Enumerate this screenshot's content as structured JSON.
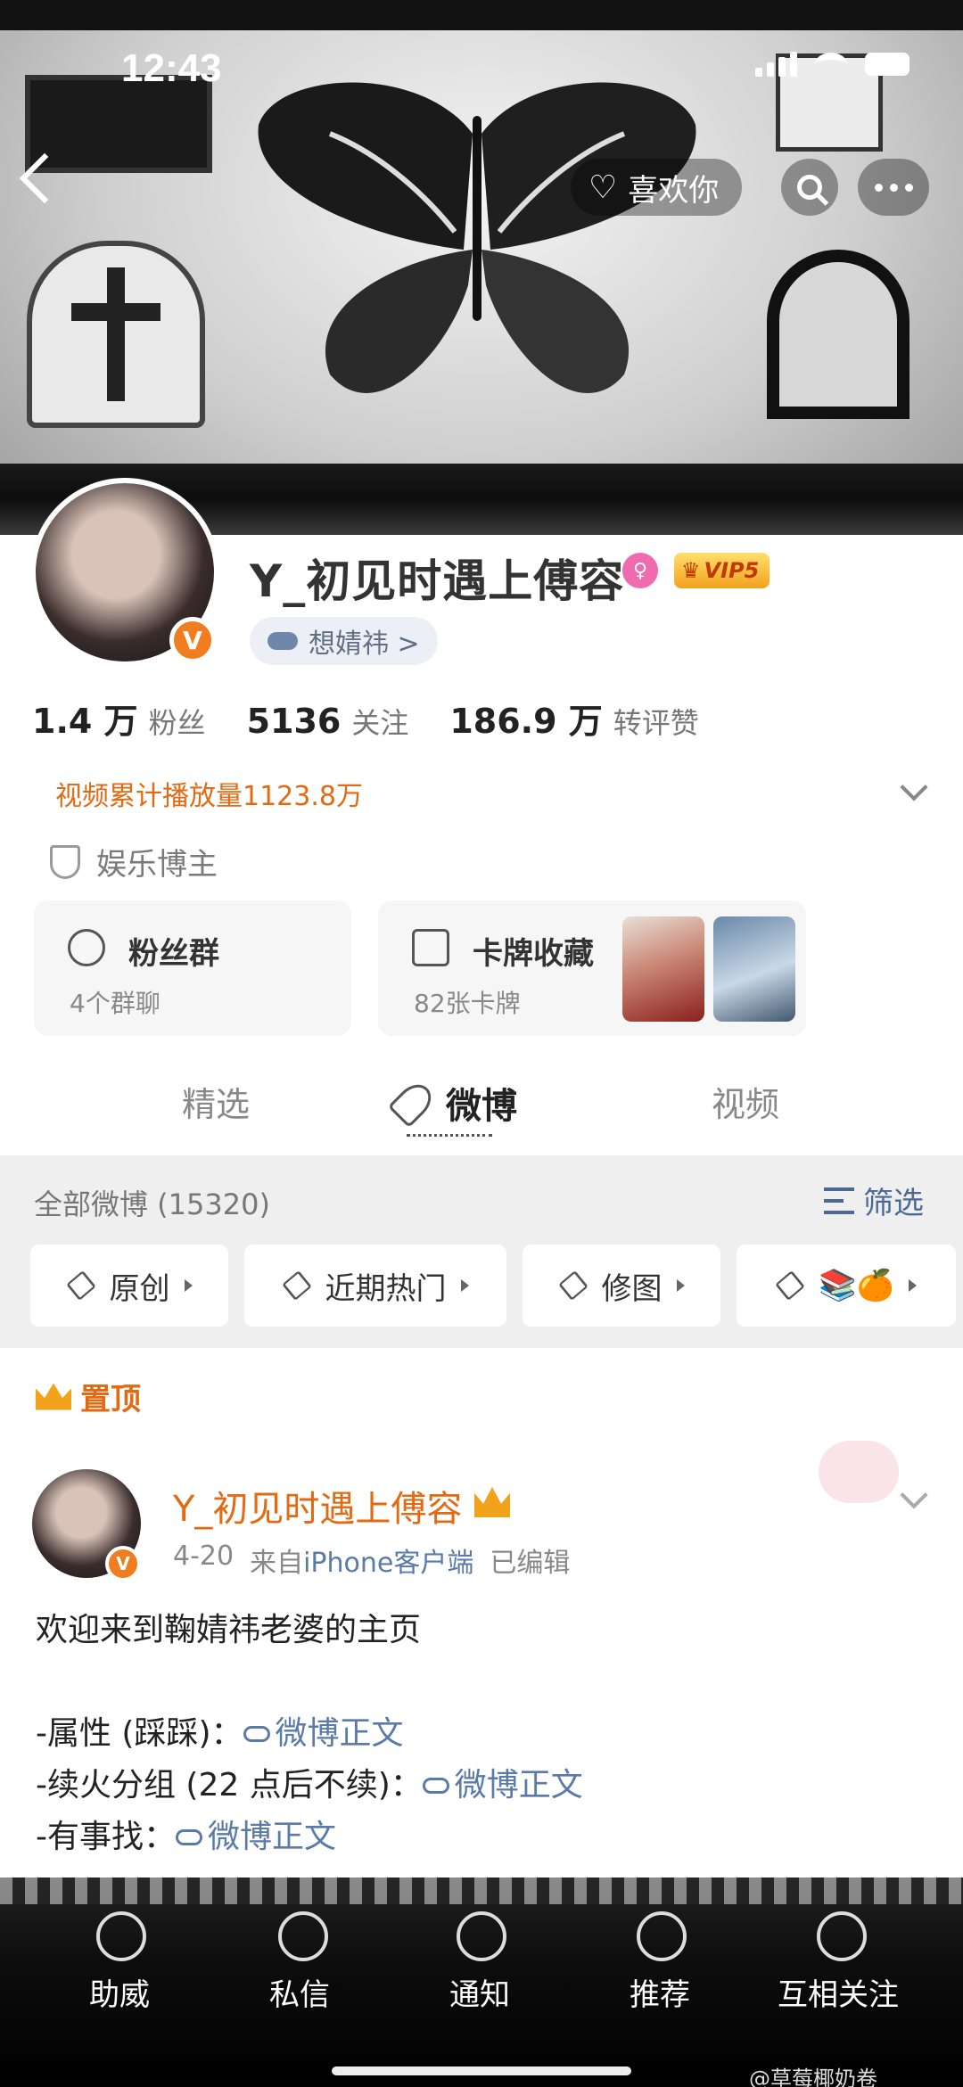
{
  "status_bar": {
    "time": "12:43"
  },
  "header": {
    "like_label": "喜欢你"
  },
  "profile": {
    "username": "Y_初见时遇上傅容",
    "vip_label": "VIP5",
    "verified_mark": "V",
    "mood_status": "想婧祎 >",
    "stats": [
      {
        "value": "1.4 万",
        "label": "粉丝"
      },
      {
        "value": "5136",
        "label": "关注"
      },
      {
        "value": "186.9 万",
        "label": "转评赞"
      }
    ],
    "video_plays": "视频累计播放量1123.8万",
    "tag": "娱乐博主"
  },
  "cards": {
    "fans_group": {
      "title": "粉丝群",
      "subtitle": "4个群聊"
    },
    "card_collection": {
      "title": "卡牌收藏",
      "subtitle": "82张卡牌"
    }
  },
  "tabs": [
    {
      "label": "精选"
    },
    {
      "label": "微博"
    },
    {
      "label": "视频"
    }
  ],
  "feed": {
    "all_count": "全部微博 (15320)",
    "filter_label": "筛选",
    "chips": [
      {
        "label": "原创"
      },
      {
        "label": "近期热门"
      },
      {
        "label": "修图"
      },
      {
        "label": "📚🍊"
      }
    ]
  },
  "pinned_post": {
    "pinned_label": "置顶",
    "author": "Y_初见时遇上傅容",
    "date": "4-20",
    "source_prefix": "来自",
    "source": "iPhone客户端",
    "edited": "已编辑",
    "line1": "欢迎来到鞠婧祎老婆的主页",
    "line2_prefix": "-属性 (踩踩)：",
    "line3_prefix": "-续火分组 (22 点后不续)：",
    "line4_prefix": "-有事找：",
    "link_text": "微博正文"
  },
  "bottom_nav": [
    {
      "label": "助威"
    },
    {
      "label": "私信"
    },
    {
      "label": "通知"
    },
    {
      "label": "推荐"
    },
    {
      "label": "互相关注"
    }
  ],
  "watermark": "@草莓椰奶卷",
  "colors": {
    "accent_orange": "#e26a12",
    "link_blue": "#5a7aa8",
    "vip_gold": "#f3a21c"
  }
}
